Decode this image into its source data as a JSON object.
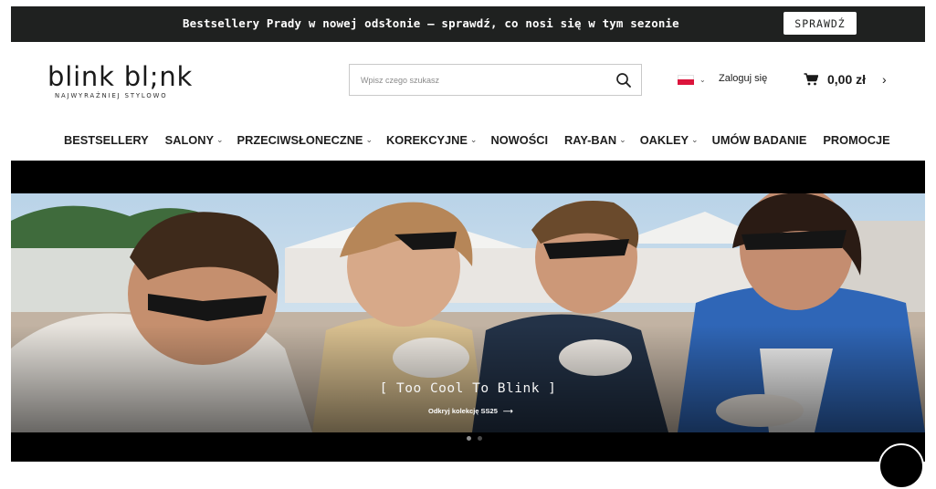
{
  "promo": {
    "text": "Bestsellery Prady w nowej odsłonie – sprawdź, co nosi się w tym sezonie",
    "button": "SPRAWDŹ"
  },
  "logo": {
    "name": "blink bl;nk",
    "tagline": "NAJWYRAŻNIEJ STYLOWO"
  },
  "search": {
    "placeholder": "Wpisz czego szukasz",
    "icon": "search-icon"
  },
  "account": {
    "flag": "poland-flag",
    "login": "Zaloguj się"
  },
  "cart": {
    "total": "0,00 zł",
    "icon": "cart-icon"
  },
  "nav": {
    "items": [
      {
        "label": "BESTSELLERY",
        "caret": ""
      },
      {
        "label": "SALONY",
        "caret": "⌄"
      },
      {
        "label": "PRZECIWSŁONECZNE",
        "caret": "⌄"
      },
      {
        "label": "KOREKCYJNE",
        "caret": "⌄"
      },
      {
        "label": "NOWOŚCI",
        "caret": ""
      },
      {
        "label": "RAY-BAN",
        "caret": "⌄"
      },
      {
        "label": "OAKLEY",
        "caret": "⌄"
      },
      {
        "label": "UMÓW BADANIE",
        "caret": ""
      },
      {
        "label": "PROMOCJE",
        "caret": ""
      }
    ]
  },
  "hero": {
    "caption": "[ Too Cool To Blink ]",
    "link": "Odkryj kolekcję SS25",
    "slides": 2,
    "active_slide": 1
  },
  "colors": {
    "dark": "#1f2120",
    "accent_red": "#dc143c"
  }
}
